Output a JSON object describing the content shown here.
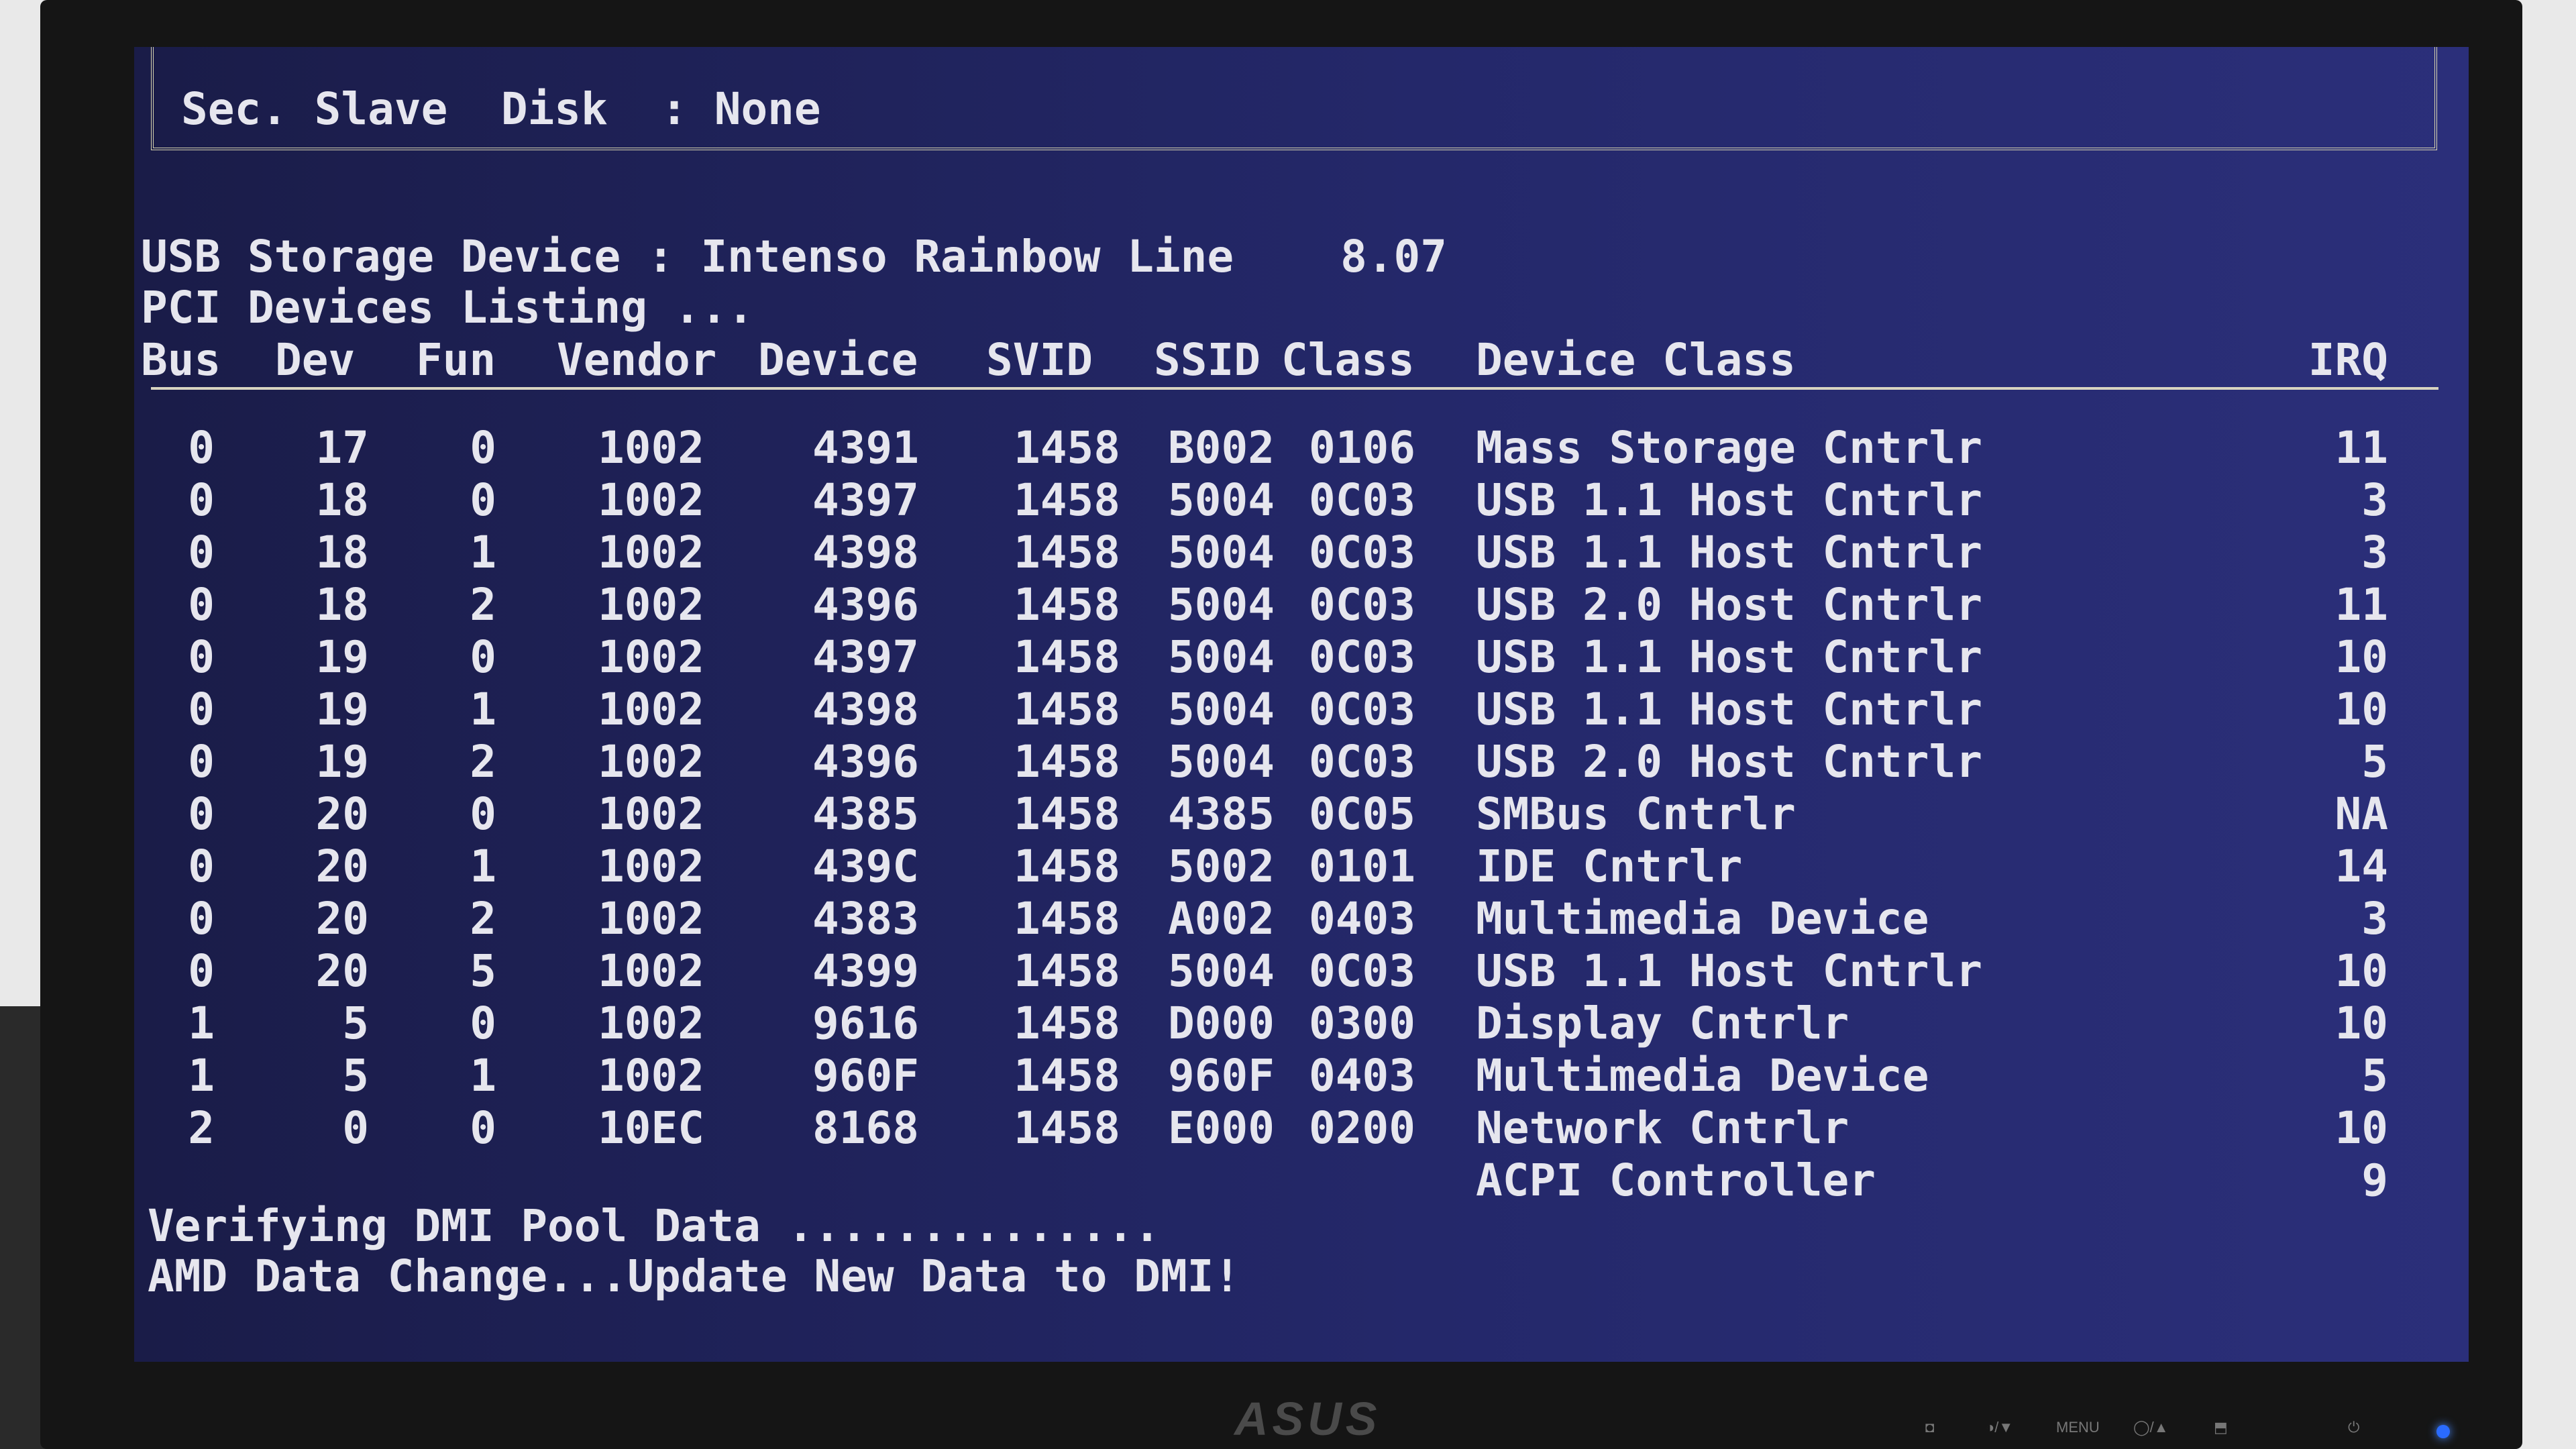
{
  "top_line": "Sec. Slave  Disk  : None",
  "usb_line": "USB Storage Device : Intenso Rainbow Line    8.07",
  "listing_line": "PCI Devices Listing ...",
  "columns": {
    "bus": "Bus",
    "dev": "Dev",
    "fun": "Fun",
    "vendor": "Vendor",
    "device": "Device",
    "svid": "SVID",
    "ssid": "SSID",
    "class": "Class",
    "device_class": "Device Class",
    "irq": "IRQ"
  },
  "rows": [
    {
      "bus": "0",
      "dev": "17",
      "fun": "0",
      "vendor": "1002",
      "device": "4391",
      "svid": "1458",
      "ssid": "B002",
      "class": "0106",
      "device_class": "Mass Storage Cntrlr",
      "irq": "11"
    },
    {
      "bus": "0",
      "dev": "18",
      "fun": "0",
      "vendor": "1002",
      "device": "4397",
      "svid": "1458",
      "ssid": "5004",
      "class": "0C03",
      "device_class": "USB 1.1 Host Cntrlr",
      "irq": "3"
    },
    {
      "bus": "0",
      "dev": "18",
      "fun": "1",
      "vendor": "1002",
      "device": "4398",
      "svid": "1458",
      "ssid": "5004",
      "class": "0C03",
      "device_class": "USB 1.1 Host Cntrlr",
      "irq": "3"
    },
    {
      "bus": "0",
      "dev": "18",
      "fun": "2",
      "vendor": "1002",
      "device": "4396",
      "svid": "1458",
      "ssid": "5004",
      "class": "0C03",
      "device_class": "USB 2.0 Host Cntrlr",
      "irq": "11"
    },
    {
      "bus": "0",
      "dev": "19",
      "fun": "0",
      "vendor": "1002",
      "device": "4397",
      "svid": "1458",
      "ssid": "5004",
      "class": "0C03",
      "device_class": "USB 1.1 Host Cntrlr",
      "irq": "10"
    },
    {
      "bus": "0",
      "dev": "19",
      "fun": "1",
      "vendor": "1002",
      "device": "4398",
      "svid": "1458",
      "ssid": "5004",
      "class": "0C03",
      "device_class": "USB 1.1 Host Cntrlr",
      "irq": "10"
    },
    {
      "bus": "0",
      "dev": "19",
      "fun": "2",
      "vendor": "1002",
      "device": "4396",
      "svid": "1458",
      "ssid": "5004",
      "class": "0C03",
      "device_class": "USB 2.0 Host Cntrlr",
      "irq": "5"
    },
    {
      "bus": "0",
      "dev": "20",
      "fun": "0",
      "vendor": "1002",
      "device": "4385",
      "svid": "1458",
      "ssid": "4385",
      "class": "0C05",
      "device_class": "SMBus Cntrlr",
      "irq": "NA"
    },
    {
      "bus": "0",
      "dev": "20",
      "fun": "1",
      "vendor": "1002",
      "device": "439C",
      "svid": "1458",
      "ssid": "5002",
      "class": "0101",
      "device_class": "IDE Cntrlr",
      "irq": "14"
    },
    {
      "bus": "0",
      "dev": "20",
      "fun": "2",
      "vendor": "1002",
      "device": "4383",
      "svid": "1458",
      "ssid": "A002",
      "class": "0403",
      "device_class": "Multimedia Device",
      "irq": "3"
    },
    {
      "bus": "0",
      "dev": "20",
      "fun": "5",
      "vendor": "1002",
      "device": "4399",
      "svid": "1458",
      "ssid": "5004",
      "class": "0C03",
      "device_class": "USB 1.1 Host Cntrlr",
      "irq": "10"
    },
    {
      "bus": "1",
      "dev": "5",
      "fun": "0",
      "vendor": "1002",
      "device": "9616",
      "svid": "1458",
      "ssid": "D000",
      "class": "0300",
      "device_class": "Display Cntrlr",
      "irq": "10"
    },
    {
      "bus": "1",
      "dev": "5",
      "fun": "1",
      "vendor": "1002",
      "device": "960F",
      "svid": "1458",
      "ssid": "960F",
      "class": "0403",
      "device_class": "Multimedia Device",
      "irq": "5"
    },
    {
      "bus": "2",
      "dev": "0",
      "fun": "0",
      "vendor": "10EC",
      "device": "8168",
      "svid": "1458",
      "ssid": "E000",
      "class": "0200",
      "device_class": "Network Cntrlr",
      "irq": "10"
    },
    {
      "bus": "",
      "dev": "",
      "fun": "",
      "vendor": "",
      "device": "",
      "svid": "",
      "ssid": "",
      "class": "",
      "device_class": "ACPI Controller",
      "irq": "9"
    }
  ],
  "footer": {
    "line1": "Verifying DMI Pool Data ..............",
    "line2": "AMD Data Change...Update New Data to DMI!"
  },
  "monitor": {
    "brand": "ASUS",
    "controls": [
      "◘",
      "◑/▼",
      "MENU",
      "◯/▲",
      "⬒",
      "⏻"
    ]
  },
  "colors": {
    "screen_bg": "#24286a",
    "text": "#e6e6ee",
    "bezel": "#151515",
    "power_led": "#2a6bff"
  }
}
